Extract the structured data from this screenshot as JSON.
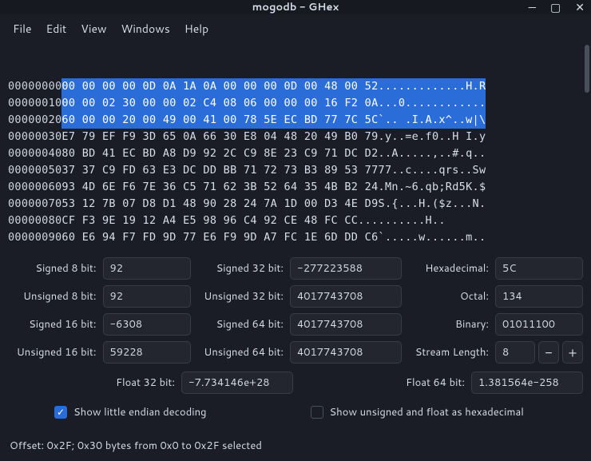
{
  "title": "mogodb - GHex",
  "menu": {
    "items": [
      "File",
      "Edit",
      "View",
      "Windows",
      "Help"
    ]
  },
  "hex": {
    "rows": [
      {
        "offset": "00000000",
        "hex": "00 00 00 00 0D 0A 1A 0A 00 00 00 0D 00 48 00 52",
        "ascii": ".............H.R",
        "sel": true,
        "sel_ascii": true
      },
      {
        "offset": "00000010",
        "hex": "00 00 02 30 00 00 02 C4 08 06 00 00 00 16 F2 0A",
        "ascii": "...0............",
        "sel": true,
        "sel_ascii": true
      },
      {
        "offset": "00000020",
        "hex": "60 00 00 20 00 49 00 41 00 78 5E EC BD 77 7C 5C",
        "ascii": "`.. .I.A.x^..w|\\",
        "sel": true,
        "sel_ascii": true
      },
      {
        "offset": "00000030",
        "hex": "E7 79 EF F9 3D 65 0A 66 30 E8 04 48 20 49 B0 79",
        "ascii": ".y..=e.f0..H I.y"
      },
      {
        "offset": "00000040",
        "hex": "80 BD 41 EC BD A8 D9 92 2C C9 8E 23 C9 71 DC D2",
        "ascii": "..A.....,..#.q.."
      },
      {
        "offset": "00000050",
        "hex": "37 37 C9 FD 63 E3 DC DD BB 71 72 73 B3 89 53 77",
        "ascii": "77..c....qrs..Sw"
      },
      {
        "offset": "00000060",
        "hex": "93 4D 6E F6 7E 36 C5 71 62 3B 52 64 35 4B B2 24",
        "ascii": ".Mn.~6.qb;Rd5K.$"
      },
      {
        "offset": "00000070",
        "hex": "53 12 7B 07 D8 D1 48 90 28 24 7A 1D 00 D3 4E D9",
        "ascii": "S.{...H.($z...N."
      },
      {
        "offset": "00000080",
        "hex": "CF F3 9E 19 12 A4 E5 98 96 C4 92 CE 48 FC CC",
        "ascii": "..........H.."
      },
      {
        "offset": "00000090",
        "hex": "60 E6 94 F7 FD 9D 77 E6 F9 9D A7 FC 1E 6D DD C6",
        "ascii": "`.....w......m.."
      }
    ]
  },
  "values": {
    "s8": {
      "label": "Signed 8 bit:",
      "value": "92"
    },
    "u8": {
      "label": "Unsigned 8 bit:",
      "value": "92"
    },
    "s16": {
      "label": "Signed 16 bit:",
      "value": "-6308"
    },
    "u16": {
      "label": "Unsigned 16 bit:",
      "value": "59228"
    },
    "s32": {
      "label": "Signed 32 bit:",
      "value": "-277223588"
    },
    "u32": {
      "label": "Unsigned 32 bit:",
      "value": "4017743708"
    },
    "s64": {
      "label": "Signed 64 bit:",
      "value": "4017743708"
    },
    "u64": {
      "label": "Unsigned 64 bit:",
      "value": "4017743708"
    },
    "f32": {
      "label": "Float 32 bit:",
      "value": "-7.734146e+28"
    },
    "f64": {
      "label": "Float 64 bit:",
      "value": "1.381564e-258"
    },
    "hex": {
      "label": "Hexadecimal:",
      "value": "5C"
    },
    "oct": {
      "label": "Octal:",
      "value": "134"
    },
    "bin": {
      "label": "Binary:",
      "value": "01011100"
    },
    "stream": {
      "label": "Stream Length:",
      "value": "8"
    }
  },
  "checks": {
    "little_endian": "Show little endian decoding",
    "unsigned_hex": "Show unsigned and float as hexadecimal"
  },
  "status": "Offset: 0x2F; 0x30 bytes from 0x0 to 0x2F selected"
}
